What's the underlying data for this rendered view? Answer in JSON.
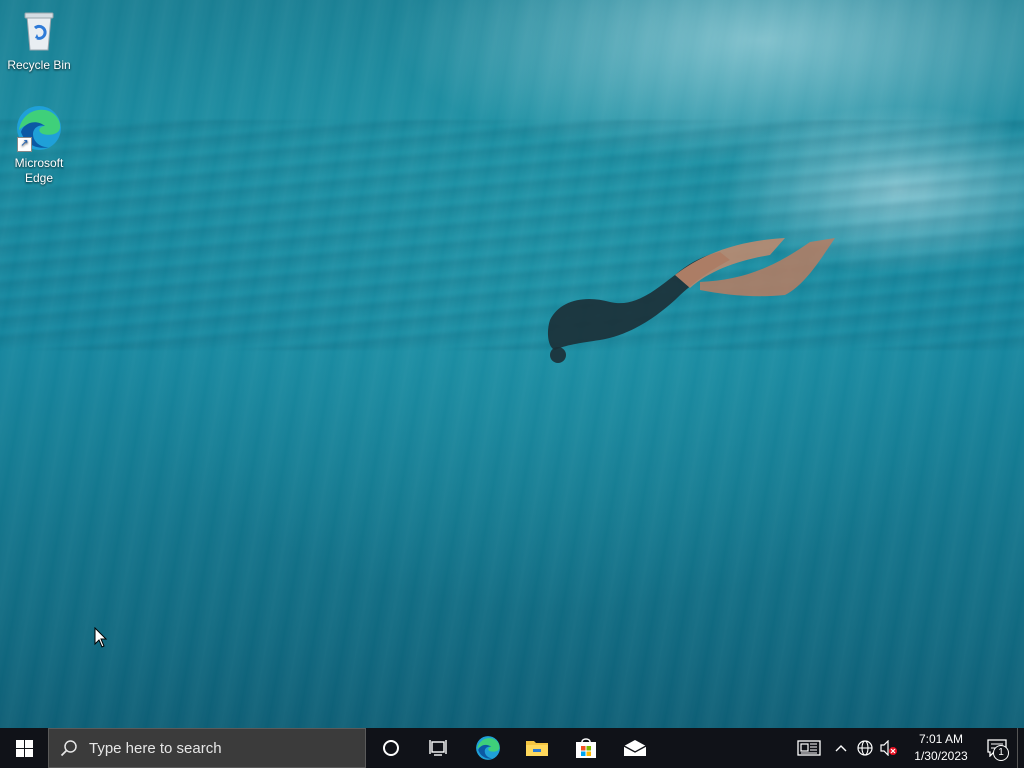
{
  "desktop": {
    "icons": [
      {
        "label": "Recycle Bin",
        "icon": "recycle-bin-icon"
      },
      {
        "label": "Microsoft Edge",
        "icon": "edge-icon"
      }
    ]
  },
  "taskbar": {
    "start_icon": "windows-logo-icon",
    "search_placeholder": "Type here to search",
    "pinned_apps": [
      {
        "name": "Microsoft Edge",
        "icon": "edge-icon"
      },
      {
        "name": "File Explorer",
        "icon": "folder-icon"
      },
      {
        "name": "Microsoft Store",
        "icon": "store-icon"
      },
      {
        "name": "Mail",
        "icon": "mail-icon"
      }
    ],
    "tray": {
      "icons": [
        "news-and-interests-icon",
        "chevron-up-icon",
        "network-icon",
        "volume-muted-icon"
      ],
      "time": "7:01 AM",
      "date": "1/30/2023",
      "notification_count": "1"
    }
  },
  "colors": {
    "taskbar_bg": "#101218",
    "search_bg": "#3b3b3b",
    "water": "#1789a1"
  }
}
